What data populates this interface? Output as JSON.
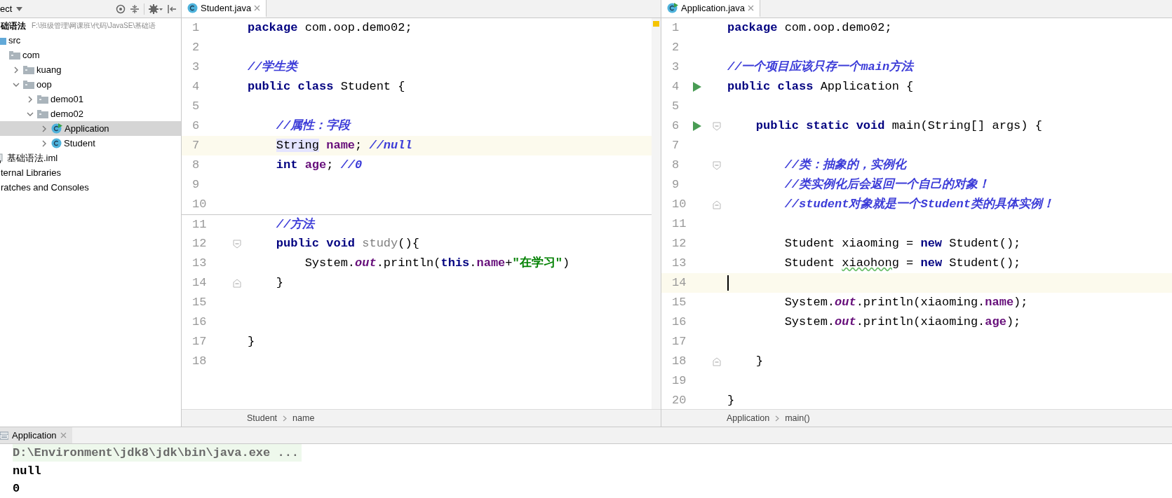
{
  "project": {
    "title": "ect",
    "tree": [
      {
        "label": "础语法",
        "path": "F:\\班级管理\\网课班\\代码\\JavaSE\\基础语",
        "selected": false,
        "children": [
          {
            "label": "src",
            "kind": "source-folder",
            "selected": false,
            "children": [
              {
                "label": "com",
                "kind": "folder",
                "selected": false,
                "children": [
                  {
                    "label": "kuang",
                    "kind": "folder",
                    "expanded": false,
                    "selected": false
                  },
                  {
                    "label": "oop",
                    "kind": "folder",
                    "expanded": true,
                    "selected": false,
                    "children": [
                      {
                        "label": "demo01",
                        "kind": "folder",
                        "expanded": false,
                        "selected": false
                      },
                      {
                        "label": "demo02",
                        "kind": "folder",
                        "expanded": true,
                        "selected": false,
                        "children": [
                          {
                            "label": "Application",
                            "kind": "class-main",
                            "expanded": false,
                            "selected": true
                          },
                          {
                            "label": "Student",
                            "kind": "class",
                            "expanded": false,
                            "selected": false
                          }
                        ]
                      }
                    ]
                  }
                ]
              }
            ]
          },
          {
            "label": "基础语法.iml",
            "kind": "module-file",
            "selected": false
          }
        ]
      },
      {
        "label": "ternal Libraries",
        "selected": false
      },
      {
        "label": "ratches and Consoles",
        "selected": false
      }
    ]
  },
  "editors": [
    {
      "tab": {
        "label": "Student.java",
        "kind": "class"
      },
      "breadcrumbs": [
        "Student",
        "name"
      ],
      "lines": [
        {
          "number": "1",
          "current": false,
          "tokens": [
            {
              "text": "package",
              "kind": "kw"
            },
            {
              "text": " com.oop.demo02;",
              "kind": "plain"
            }
          ]
        },
        {
          "number": "2",
          "current": false
        },
        {
          "number": "3",
          "current": false,
          "tokens": [
            {
              "text": "//学生类",
              "kind": "comment"
            }
          ]
        },
        {
          "number": "4",
          "current": false,
          "tokens": [
            {
              "text": "public class",
              "kind": "kw"
            },
            {
              "text": " Student {",
              "kind": "plain"
            }
          ]
        },
        {
          "number": "5",
          "current": false
        },
        {
          "number": "6",
          "current": false,
          "tokens": [
            {
              "text": "    //属性：字段",
              "kind": "comment"
            }
          ]
        },
        {
          "number": "7",
          "current": true,
          "tokens": [
            {
              "text": "    String",
              "kind": "usage"
            },
            {
              "text": " name",
              "kind": "field"
            },
            {
              "text": "; ",
              "kind": "plain"
            },
            {
              "text": "//null",
              "kind": "comment"
            }
          ]
        },
        {
          "number": "8",
          "current": false,
          "tokens": [
            {
              "text": "    int",
              "kind": "kw"
            },
            {
              "text": " age",
              "kind": "field"
            },
            {
              "text": "; ",
              "kind": "plain"
            },
            {
              "text": "//0",
              "kind": "comment"
            }
          ]
        },
        {
          "number": "9",
          "current": false
        },
        {
          "number": "10",
          "current": false
        },
        {
          "number": "11",
          "current": false,
          "separator_above": true,
          "tokens": [
            {
              "text": "    //方法",
              "kind": "comment"
            }
          ]
        },
        {
          "number": "12",
          "current": false,
          "fold": {
            "kind": "start"
          },
          "tokens": [
            {
              "text": "    public void",
              "kind": "kw"
            },
            {
              "text": " study",
              "kind": "unused"
            },
            {
              "text": "(){",
              "kind": "plain"
            }
          ]
        },
        {
          "number": "13",
          "current": false,
          "tokens": [
            {
              "text": "        System.",
              "kind": "plain"
            },
            {
              "text": "out",
              "kind": "static"
            },
            {
              "text": ".println(",
              "kind": "plain"
            },
            {
              "text": "this",
              "kind": "kw"
            },
            {
              "text": ".",
              "kind": "plain"
            },
            {
              "text": "name",
              "kind": "field"
            },
            {
              "text": "+",
              "kind": "plain"
            },
            {
              "text": "\"在学习\"",
              "kind": "string"
            },
            {
              "text": ")",
              "kind": "plain"
            }
          ]
        },
        {
          "number": "14",
          "current": false,
          "fold": {
            "kind": "end"
          },
          "tokens": [
            {
              "text": "    }",
              "kind": "plain"
            }
          ]
        },
        {
          "number": "15",
          "current": false
        },
        {
          "number": "16",
          "current": false
        },
        {
          "number": "17",
          "current": false,
          "tokens": [
            {
              "text": "}",
              "kind": "plain"
            }
          ]
        },
        {
          "number": "18",
          "current": false
        }
      ]
    },
    {
      "tab": {
        "label": "Application.java",
        "kind": "class-main"
      },
      "breadcrumbs": [
        "Application",
        "main()"
      ],
      "lines": [
        {
          "number": "1",
          "current": false,
          "tokens": [
            {
              "text": "package",
              "kind": "kw"
            },
            {
              "text": " com.oop.demo02;",
              "kind": "plain"
            }
          ]
        },
        {
          "number": "2",
          "current": false
        },
        {
          "number": "3",
          "current": false,
          "tokens": [
            {
              "text": "//一个项目应该只存一个main方法",
              "kind": "comment"
            }
          ]
        },
        {
          "number": "4",
          "current": false,
          "run": true,
          "tokens": [
            {
              "text": "public class",
              "kind": "kw"
            },
            {
              "text": " Application {",
              "kind": "plain"
            }
          ]
        },
        {
          "number": "5",
          "current": false
        },
        {
          "number": "6",
          "current": false,
          "run": true,
          "fold": {
            "kind": "start"
          },
          "tokens": [
            {
              "text": "    public static void",
              "kind": "kw"
            },
            {
              "text": " main(String[] args) {",
              "kind": "plain"
            }
          ]
        },
        {
          "number": "7",
          "current": false
        },
        {
          "number": "8",
          "current": false,
          "fold": {
            "kind": "start"
          },
          "tokens": [
            {
              "text": "        //类：抽象的，实例化",
              "kind": "comment"
            }
          ]
        },
        {
          "number": "9",
          "current": false,
          "tokens": [
            {
              "text": "        //类实例化后会返回一个自己的对象！",
              "kind": "comment"
            }
          ]
        },
        {
          "number": "10",
          "current": false,
          "fold": {
            "kind": "end"
          },
          "tokens": [
            {
              "text": "        //student对象就是一个Student类的具体实例！",
              "kind": "comment"
            }
          ]
        },
        {
          "number": "11",
          "current": false
        },
        {
          "number": "12",
          "current": false,
          "tokens": [
            {
              "text": "        Student xiaoming = ",
              "kind": "plain"
            },
            {
              "text": "new",
              "kind": "kw"
            },
            {
              "text": " Student();",
              "kind": "plain"
            }
          ]
        },
        {
          "number": "13",
          "current": false,
          "tokens": [
            {
              "text": "        Student ",
              "kind": "plain"
            },
            {
              "text": "xiaohong",
              "kind": "typo"
            },
            {
              "text": " = ",
              "kind": "plain"
            },
            {
              "text": "new",
              "kind": "kw"
            },
            {
              "text": " Student();",
              "kind": "plain"
            }
          ]
        },
        {
          "number": "14",
          "current": true,
          "caret": true
        },
        {
          "number": "15",
          "current": false,
          "tokens": [
            {
              "text": "        System.",
              "kind": "plain"
            },
            {
              "text": "out",
              "kind": "static"
            },
            {
              "text": ".println(xiaoming.",
              "kind": "plain"
            },
            {
              "text": "name",
              "kind": "field"
            },
            {
              "text": ");",
              "kind": "plain"
            }
          ]
        },
        {
          "number": "16",
          "current": false,
          "tokens": [
            {
              "text": "        System.",
              "kind": "plain"
            },
            {
              "text": "out",
              "kind": "static"
            },
            {
              "text": ".println(xiaoming.",
              "kind": "plain"
            },
            {
              "text": "age",
              "kind": "field"
            },
            {
              "text": ");",
              "kind": "plain"
            }
          ]
        },
        {
          "number": "17",
          "current": false
        },
        {
          "number": "18",
          "current": false,
          "fold": {
            "kind": "end"
          },
          "tokens": [
            {
              "text": "    }",
              "kind": "plain"
            }
          ]
        },
        {
          "number": "19",
          "current": false
        },
        {
          "number": "20",
          "current": false,
          "tokens": [
            {
              "text": "}",
              "kind": "plain"
            }
          ]
        }
      ]
    }
  ],
  "run": {
    "tab": {
      "label": "Application"
    },
    "output": [
      {
        "kind": "command",
        "text": "D:\\Environment\\jdk8\\jdk\\bin\\java.exe ..."
      },
      {
        "kind": "output",
        "text": "null"
      },
      {
        "kind": "output",
        "text": "0"
      }
    ]
  }
}
